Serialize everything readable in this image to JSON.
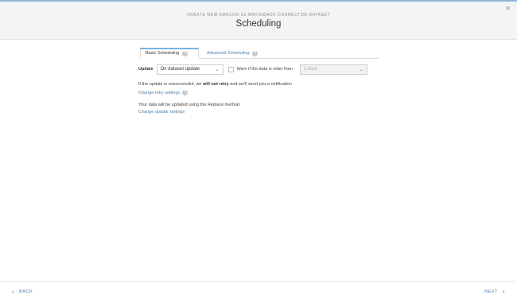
{
  "header": {
    "subtitle": "CREATE NEW AMAZON S3 WRITEBACK CONNECTOR DATASET",
    "title": "Scheduling",
    "close_icon": "×"
  },
  "tabs": [
    {
      "label": "Basic Scheduling",
      "active": true
    },
    {
      "label": "Advanced Scheduling",
      "active": false
    }
  ],
  "help_glyph": "?",
  "update_row": {
    "label": "Update",
    "select_value": "On dataset update",
    "warn_label": "Warn if the data is older than",
    "warn_select_value": "1 hour"
  },
  "retry": {
    "text_before": "If the update is unsuccessful, we ",
    "text_bold": "will not retry",
    "text_after": " and we'll send you a notification",
    "link": "Change retry settings"
  },
  "update_method": {
    "text": "Your data will be updated using the Replace method.",
    "link": "Change update settings"
  },
  "footer": {
    "back_label": "BACK",
    "next_label": "NEXT"
  },
  "colors": {
    "accent": "#4a7fb0",
    "tab_active_border": "#7ab2df"
  }
}
